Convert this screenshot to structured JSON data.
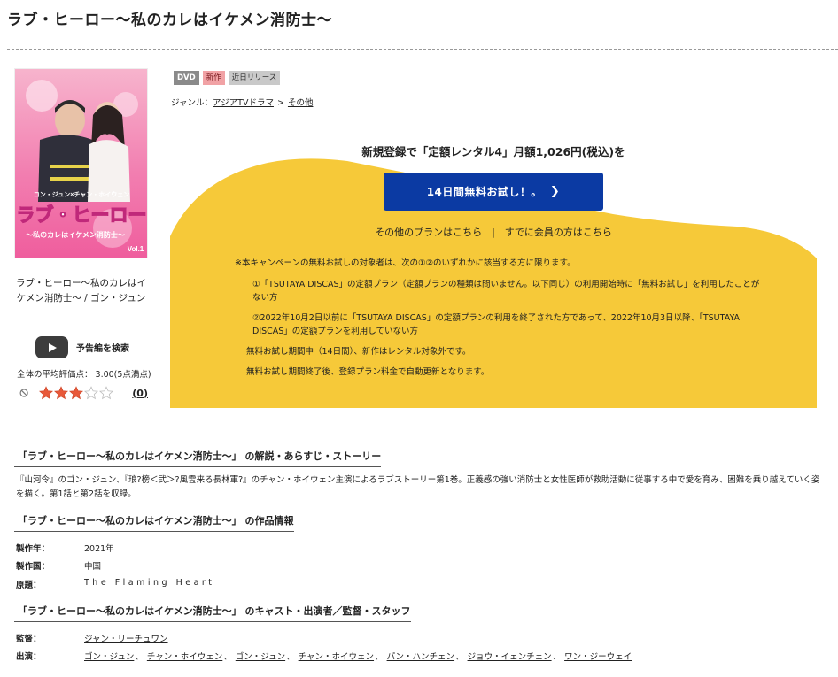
{
  "page_title": "ラブ・ヒーロー〜私のカレはイケメン消防士〜",
  "cover": {
    "logo_text": "ラブ・ヒーロー",
    "subtitle_text": "〜私のカレはイケメン消防士〜",
    "cast_text": "コン・ジュン×チャン・ホイウェン",
    "volume_text": "Vol.1"
  },
  "cover_caption": "ラブ・ヒーロー〜私のカレはイケメン消防士〜 / ゴン・ジュン",
  "trailer_label": "予告編を検索",
  "rating": {
    "text": "全体の平均評価点： 3.00(5点満点)",
    "value": 3,
    "max": 5,
    "review_count": "(0)"
  },
  "badges": [
    "DVD",
    "新作",
    "近日リリース"
  ],
  "genre": {
    "label": "ジャンル：",
    "links": [
      "アジアTVドラマ",
      "その他"
    ],
    "separator": ">"
  },
  "campaign": {
    "headline": "新規登録で「定額レンタル4」月額1,026円(税込)を",
    "button_label": "14日間無料お試し！。",
    "other_plans_link": "その他のプランはこちら",
    "divider": "|",
    "member_link": "すでに会員の方はこちら",
    "bg_color": "#f6c939",
    "button_color": "#0b3aa3",
    "notes": {
      "head": "※本キャンペーンの無料お試しの対象者は、次の①②のいずれかに該当する方に限ります。",
      "item1": "①「TSUTAYA DISCAS」の定額プラン（定額プランの種類は問いません。以下同じ）の利用開始時に「無料お試し」を利用したことがない方",
      "item2": "②2022年10月2日以前に「TSUTAYA DISCAS」の定額プランの利用を終了された方であって、2022年10月3日以降、「TSUTAYA DISCAS」の定額プランを利用していない方",
      "line1": "無料お試し期間中（14日間）、新作はレンタル対象外です。",
      "line2": "無料お試し期間終了後、登録プラン料金で自動更新となります。"
    }
  },
  "synopsis": {
    "title": "「ラブ・ヒーロー〜私のカレはイケメン消防士〜」 の解説・あらすじ・ストーリー",
    "body": "『山河令』のゴン・ジュン、『琅?榜＜弐＞?風雲来る長林軍?』のチャン・ホイウェン主演によるラブストーリー第1巻。正義感の強い消防士と女性医師が救助活動に従事する中で愛を育み、困難を乗り越えていく姿を描く。第1話と第2話を収録。"
  },
  "work_info": {
    "title": "「ラブ・ヒーロー〜私のカレはイケメン消防士〜」 の作品情報",
    "year_label": "製作年：",
    "year_value": "2021年",
    "country_label": "製作国：",
    "country_value": "中国",
    "original_label": "原題：",
    "original_value": "The Flaming Heart"
  },
  "cast": {
    "title": "「ラブ・ヒーロー〜私のカレはイケメン消防士〜」 のキャスト・出演者／監督・スタッフ",
    "director_label": "監督：",
    "director": "ジャン・リーチュワン",
    "actors_label": "出演：",
    "actors": [
      "ゴン・ジュン",
      "チャン・ホイウェン",
      "ゴン・ジュン",
      "チャン・ホイウェン",
      "パン・ハンチェン",
      "ジョウ・イェンチェン",
      "ワン・ジーウェイ"
    ],
    "separator": "、"
  }
}
